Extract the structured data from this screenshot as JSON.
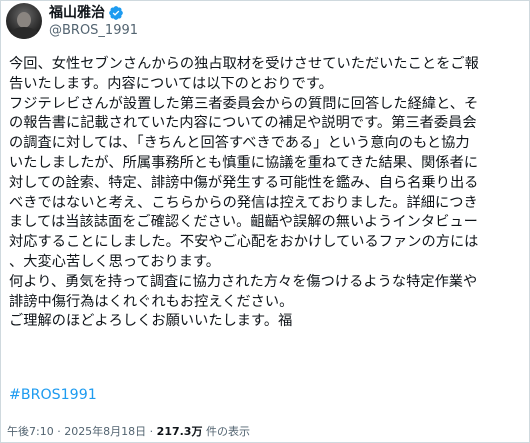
{
  "post": {
    "author": {
      "display_name": "福山雅治",
      "handle": "@BROS_1991",
      "verified_icon": "verified-badge-icon",
      "verified_color": "#1d9bf0"
    },
    "body_lines": [
      "今回、女性セブンさんからの独占取材を受けさせていただいたことをご報",
      "告いたします。内容については以下のとおりです。",
      "フジテレビさんが設置した第三者委員会からの質問に回答した経緯と、そ",
      "の報告書に記載されていた内容についての補足や説明です。第三者委員会",
      "の調査に対しては、「きちんと回答すべきである」という意向のもと協力",
      "いたしましたが、所属事務所とも慎重に協議を重ねてきた結果、関係者に",
      "対しての詮索、特定、誹謗中傷が発生する可能性を鑑み、自ら名乗り出る",
      "べきではないと考え、こちらからの発信は控えておりました。詳細につき",
      "ましては当該誌面をご確認ください。齟齬や誤解の無いようインタビュー",
      "対応することにしました。不安やご心配をおかけしているファンの方には",
      "、大変心苦しく思っております。",
      "何より、勇気を持って調査に協力された方々を傷つけるような特定作業や",
      "誹謗中傷行為はくれぐれもお控えください。",
      "ご理解のほどよろしくお願いいたします。福"
    ],
    "hashtag": "#BROS1991",
    "hashtag_color": "#1d9bf0",
    "timestamp": "午後7:10 · 2025年8月18日 · ",
    "views_count": "217.3万",
    "views_suffix": " 件の表示"
  }
}
